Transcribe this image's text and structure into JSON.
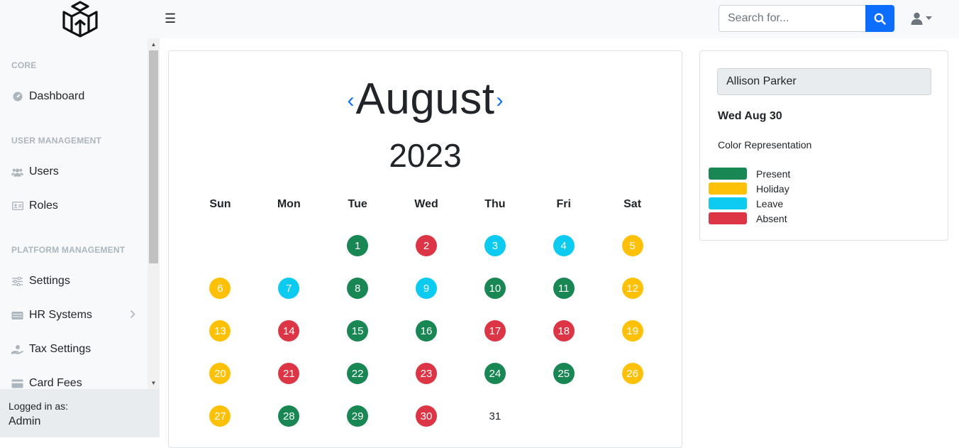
{
  "topbar": {
    "menu_icon": "hamburger-icon",
    "search": {
      "placeholder": "Search for...",
      "value": ""
    },
    "search_icon": "search-icon",
    "user_icon": "user-icon"
  },
  "sidebar": {
    "sections": [
      {
        "heading": "CORE",
        "items": [
          {
            "label": "Dashboard",
            "icon": "gauge-icon"
          }
        ]
      },
      {
        "heading": "USER MANAGEMENT",
        "items": [
          {
            "label": "Users",
            "icon": "users-icon"
          },
          {
            "label": "Roles",
            "icon": "id-card-icon"
          }
        ]
      },
      {
        "heading": "PLATFORM MANAGEMENT",
        "items": [
          {
            "label": "Settings",
            "icon": "sliders-icon"
          },
          {
            "label": "HR Systems",
            "icon": "server-icon",
            "has_submenu": true
          },
          {
            "label": "Tax Settings",
            "icon": "hand-coin-icon"
          },
          {
            "label": "Card Fees",
            "icon": "card-icon"
          }
        ]
      }
    ],
    "footer": {
      "label": "Logged in as:",
      "user": "Admin"
    }
  },
  "calendar": {
    "month": "August",
    "year": "2023",
    "prev": "‹",
    "next": "›",
    "weekdays": [
      "Sun",
      "Mon",
      "Tue",
      "Wed",
      "Thu",
      "Fri",
      "Sat"
    ],
    "first_weekday_index": 2,
    "days": [
      {
        "day": 1,
        "status": "present"
      },
      {
        "day": 2,
        "status": "absent"
      },
      {
        "day": 3,
        "status": "leave"
      },
      {
        "day": 4,
        "status": "leave"
      },
      {
        "day": 5,
        "status": "holiday"
      },
      {
        "day": 6,
        "status": "holiday"
      },
      {
        "day": 7,
        "status": "leave"
      },
      {
        "day": 8,
        "status": "present"
      },
      {
        "day": 9,
        "status": "leave"
      },
      {
        "day": 10,
        "status": "present"
      },
      {
        "day": 11,
        "status": "present"
      },
      {
        "day": 12,
        "status": "holiday"
      },
      {
        "day": 13,
        "status": "holiday"
      },
      {
        "day": 14,
        "status": "absent"
      },
      {
        "day": 15,
        "status": "present"
      },
      {
        "day": 16,
        "status": "present"
      },
      {
        "day": 17,
        "status": "absent"
      },
      {
        "day": 18,
        "status": "absent"
      },
      {
        "day": 19,
        "status": "holiday"
      },
      {
        "day": 20,
        "status": "holiday"
      },
      {
        "day": 21,
        "status": "absent"
      },
      {
        "day": 22,
        "status": "present"
      },
      {
        "day": 23,
        "status": "absent"
      },
      {
        "day": 24,
        "status": "present"
      },
      {
        "day": 25,
        "status": "present"
      },
      {
        "day": 26,
        "status": "holiday"
      },
      {
        "day": 27,
        "status": "holiday"
      },
      {
        "day": 28,
        "status": "present"
      },
      {
        "day": 29,
        "status": "present"
      },
      {
        "day": 30,
        "status": "absent"
      },
      {
        "day": 31,
        "status": "none"
      }
    ]
  },
  "info": {
    "employee": "Allison Parker",
    "selected_date": "Wed Aug 30",
    "legend_title": "Color Representation",
    "legend": [
      {
        "key": "present",
        "label": "Present",
        "color": "#198754"
      },
      {
        "key": "holiday",
        "label": "Holiday",
        "color": "#ffc107"
      },
      {
        "key": "leave",
        "label": "Leave",
        "color": "#0dcaf0"
      },
      {
        "key": "absent",
        "label": "Absent",
        "color": "#dc3545"
      }
    ]
  }
}
